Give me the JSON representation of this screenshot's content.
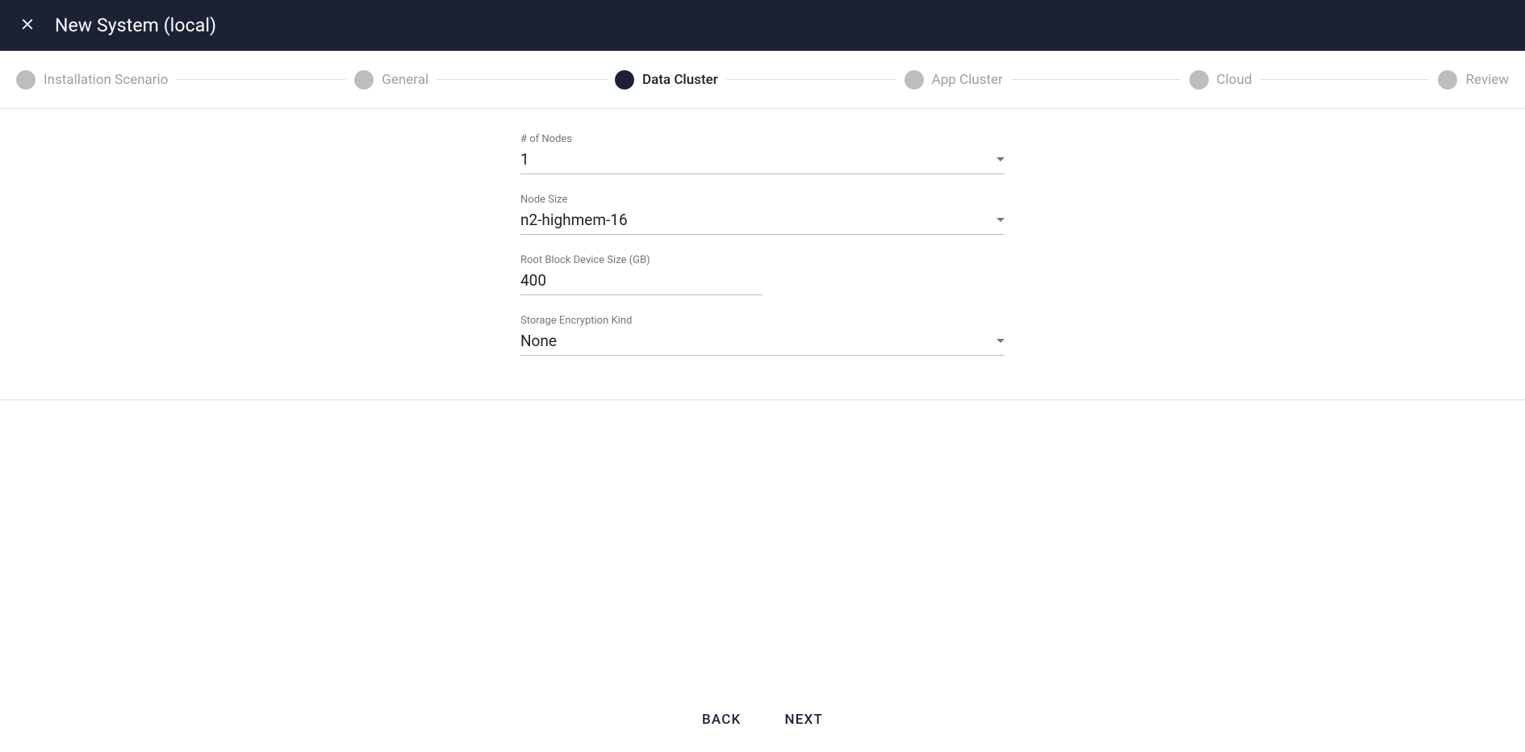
{
  "header": {
    "title": "New System (local)"
  },
  "stepper": {
    "steps": [
      {
        "label": "Installation Scenario",
        "active": false
      },
      {
        "label": "General",
        "active": false
      },
      {
        "label": "Data Cluster",
        "active": true
      },
      {
        "label": "App Cluster",
        "active": false
      },
      {
        "label": "Cloud",
        "active": false
      },
      {
        "label": "Review",
        "active": false
      }
    ]
  },
  "form": {
    "num_nodes": {
      "label": "# of Nodes",
      "value": "1"
    },
    "node_size": {
      "label": "Node Size",
      "value": "n2-highmem-16"
    },
    "root_block": {
      "label": "Root Block Device Size (GB)",
      "value": "400"
    },
    "storage_enc": {
      "label": "Storage Encryption Kind",
      "value": "None"
    }
  },
  "actions": {
    "back": "Back",
    "next": "Next"
  }
}
